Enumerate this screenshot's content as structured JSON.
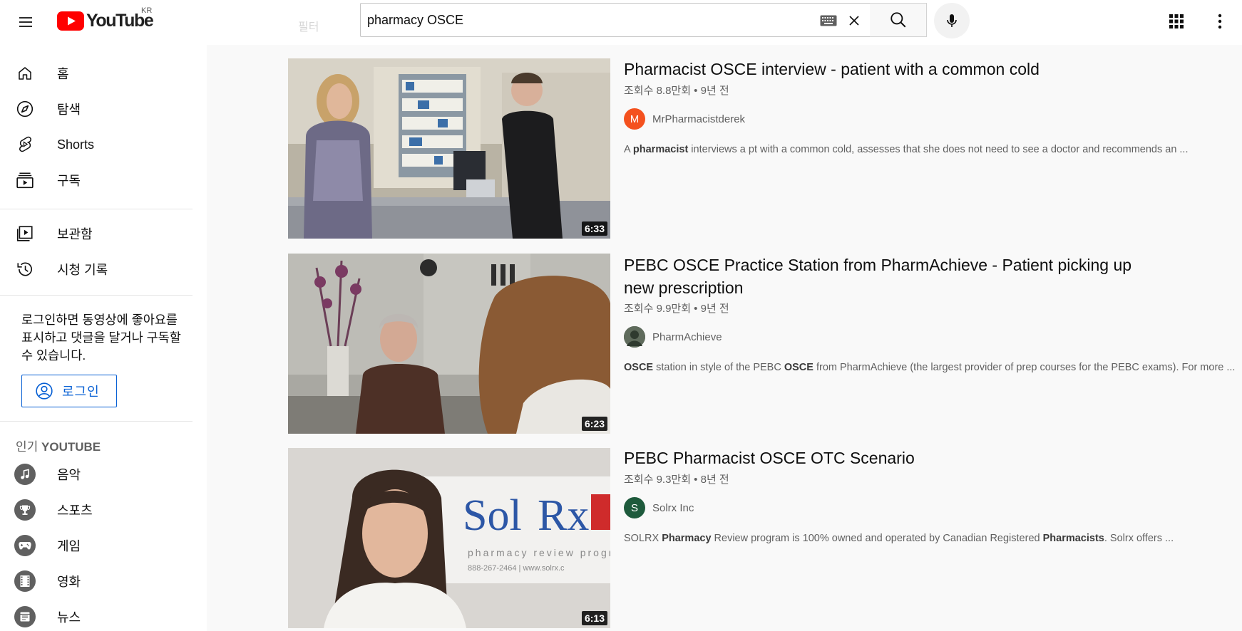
{
  "header": {
    "logo_text": "YouTube",
    "country": "KR",
    "search_value": "pharmacy OSCE",
    "faded_filter_label": "필터"
  },
  "sidebar": {
    "main_items": [
      {
        "label": "홈",
        "icon": "home-icon"
      },
      {
        "label": "탐색",
        "icon": "compass-icon"
      },
      {
        "label": "Shorts",
        "icon": "shorts-icon"
      },
      {
        "label": "구독",
        "icon": "subscriptions-icon"
      }
    ],
    "library_items": [
      {
        "label": "보관함",
        "icon": "library-icon"
      },
      {
        "label": "시청 기록",
        "icon": "history-icon"
      }
    ],
    "login_prompt": "로그인하면 동영상에 좋아요를 표시하고 댓글을 달거나 구독할 수 있습니다.",
    "login_button": "로그인",
    "section_prefix": "인기 ",
    "section_name": "YOUTUBE",
    "popular_items": [
      {
        "label": "음악",
        "icon": "music-note-icon"
      },
      {
        "label": "스포츠",
        "icon": "trophy-icon"
      },
      {
        "label": "게임",
        "icon": "gamepad-icon"
      },
      {
        "label": "영화",
        "icon": "film-icon"
      },
      {
        "label": "뉴스",
        "icon": "newspaper-icon"
      }
    ]
  },
  "results": [
    {
      "title": "Pharmacist OSCE interview - patient with a common cold",
      "meta": "조회수 8.8만회 • 9년 전",
      "channel": "MrPharmacistderek",
      "avatar_letter": "M",
      "avatar_color": "#f4511e",
      "duration": "6:33",
      "desc_parts": [
        {
          "t": "A ",
          "b": false
        },
        {
          "t": "pharmacist",
          "b": true
        },
        {
          "t": " interviews a pt with a common cold, assesses that she does not need to see a doctor and recommends an ...",
          "b": false
        }
      ]
    },
    {
      "title": "PEBC OSCE Practice Station from PharmAchieve - Patient picking up new prescription",
      "meta": "조회수 9.9만회 • 9년 전",
      "channel": "PharmAchieve",
      "avatar_letter": "",
      "avatar_color": "#4a5a4a",
      "duration": "6:23",
      "desc_parts": [
        {
          "t": "OSCE",
          "b": true
        },
        {
          "t": " station in style of the PEBC ",
          "b": false
        },
        {
          "t": "OSCE",
          "b": true
        },
        {
          "t": " from PharmAchieve (the largest provider of prep courses for the PEBC exams). For more ...",
          "b": false
        }
      ]
    },
    {
      "title": "PEBC Pharmacist OSCE OTC Scenario",
      "meta": "조회수 9.3만회 • 8년 전",
      "channel": "Solrx Inc",
      "avatar_letter": "S",
      "avatar_color": "#1e5a3c",
      "duration": "6:13",
      "desc_parts": [
        {
          "t": "SOLRX ",
          "b": false
        },
        {
          "t": "Pharmacy",
          "b": true
        },
        {
          "t": " Review program is 100% owned and operated by Canadian Registered ",
          "b": false
        },
        {
          "t": "Pharmacists",
          "b": true
        },
        {
          "t": ". Solrx offers ...",
          "b": false
        }
      ]
    }
  ],
  "thumb3_sign": {
    "brand_sol": "Sol",
    "brand_rx": "Rx",
    "line1": "pharmacy review progr",
    "line2": "888-267-2464 | www.solrx.c"
  }
}
